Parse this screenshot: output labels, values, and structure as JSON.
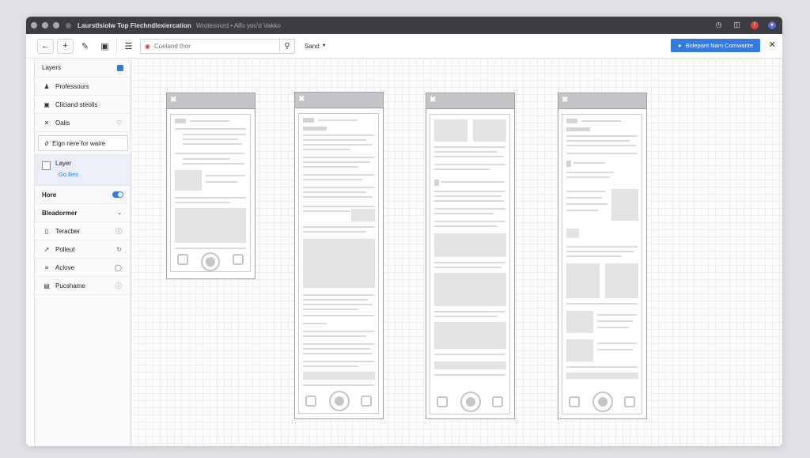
{
  "titlebar": {
    "app_title": "Laurstlsiolw Top Flechndlexiercation",
    "subtitle": "Wrotesourd • Alfo you'd Vakko"
  },
  "toolbar": {
    "back_icon": "arrow-left-icon",
    "add_icon": "plus-icon",
    "pen_icon": "pen-icon",
    "save_icon": "floppy-icon",
    "menu_icon": "hamburger-icon",
    "search_placeholder": "Coeland thor",
    "send_label": "Sand",
    "primary_button_label": "Bolepant Nam Comwarite",
    "accent_color": "#2f7de1"
  },
  "sidebar": {
    "header": "Layers",
    "items": [
      {
        "label": "Professours",
        "icon": "users-icon"
      },
      {
        "label": "Cliciand steolls",
        "icon": "folder-icon"
      },
      {
        "label": "Oalis",
        "icon": "cross-icon"
      }
    ],
    "input_text": "Eign nere for waire",
    "layer_card": {
      "title": "Layer",
      "link": "Go llies"
    },
    "hore_label": "Hore",
    "section_label": "Bleadormer",
    "list": [
      {
        "label": "Teracber",
        "icon": "device-icon"
      },
      {
        "label": "Polleut",
        "icon": "cursor-icon"
      },
      {
        "label": "Aclove",
        "icon": "list-icon"
      },
      {
        "label": "Pucshame",
        "icon": "screen-icon"
      }
    ]
  }
}
